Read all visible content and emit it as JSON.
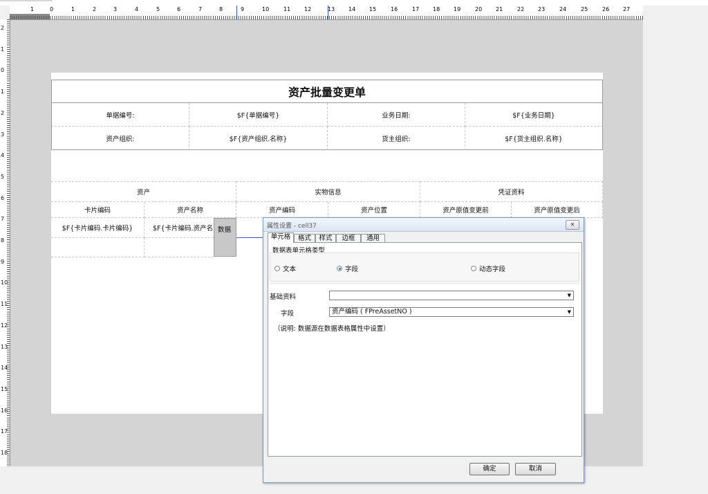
{
  "ruler": {
    "h_labels": [
      "1",
      "0",
      "1",
      "2",
      "3",
      "4",
      "5",
      "6",
      "7",
      "8",
      "9",
      "10",
      "11",
      "12",
      "13",
      "14",
      "15",
      "16",
      "17",
      "18",
      "19",
      "20",
      "21",
      "22",
      "23",
      "24",
      "25",
      "26",
      "27"
    ],
    "v_labels": [
      "2",
      "1",
      "0",
      "1",
      "2",
      "3",
      "4",
      "5",
      "6",
      "7",
      "8",
      "9",
      "10",
      "11",
      "12",
      "13",
      "14",
      "15",
      "16",
      "17",
      "18"
    ]
  },
  "report": {
    "title": "资产批量变更单",
    "header_rows": [
      [
        "单据编号:",
        "$F{单据编号}",
        "业务日期:",
        "$F{业务日期}"
      ],
      [
        "资产组织:",
        "$F{资产组织.名称}",
        "货主组织:",
        "$F{货主组织.名称}"
      ]
    ],
    "groups": [
      "资产",
      "实物信息",
      "凭证资料"
    ],
    "columns": [
      "卡片编码",
      "资产名称",
      "资产编码",
      "资产位置",
      "资产原值变更前",
      "资产原值变更后"
    ],
    "data_row": [
      "$F{卡片编码.卡片编码}",
      "$F{卡片编码.资产名",
      "数据"
    ]
  },
  "dialog": {
    "title": "属性设置 - cell37",
    "close_glyph": "✕",
    "tabs": [
      "单元格",
      "格式",
      "样式",
      "边框",
      "通用"
    ],
    "group_label": "数据表单元格类型",
    "radios": [
      {
        "label": "文本",
        "checked": false
      },
      {
        "label": "字段",
        "checked": true
      },
      {
        "label": "动态字段",
        "checked": false
      }
    ],
    "basic_label": "基础资料",
    "basic_value": "",
    "field_label": "字段",
    "field_value": "资产编码 ( FPreAssetNO )",
    "note": "（说明: 数据源在数据表格属性中设置）",
    "ok": "确定",
    "cancel": "取消"
  }
}
